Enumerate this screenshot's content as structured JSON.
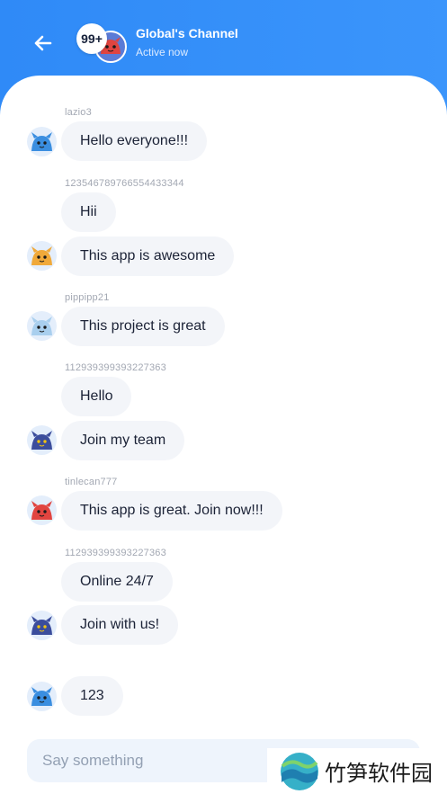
{
  "header": {
    "back_icon": "arrow-left-icon",
    "unread_count": "99+",
    "channel_name": "Global's Channel",
    "status": "Active now"
  },
  "messages": [
    {
      "sender": "lazio3",
      "text": "Hello everyone!!!",
      "avatar": "blue-dragon-avatar"
    },
    {
      "sender": "123546789766554433344",
      "text": "Hii",
      "avatar": ""
    },
    {
      "sender": "",
      "text": "This app is awesome",
      "avatar": "orange-dragon-avatar"
    },
    {
      "sender": "pippipp21",
      "text": "This project is great",
      "avatar": "light-blue-dragon-avatar"
    },
    {
      "sender": "112939399393227363",
      "text": "Hello",
      "avatar": ""
    },
    {
      "sender": "",
      "text": "Join my team",
      "avatar": "dark-blue-dragon-avatar"
    },
    {
      "sender": "tinlecan777",
      "text": "This app is great. Join now!!!",
      "avatar": "red-dragon-avatar"
    },
    {
      "sender": "112939399393227363",
      "text": "Online 24/7",
      "avatar": ""
    },
    {
      "sender": "",
      "text": "Join with us!",
      "avatar": "dark-blue-dragon-avatar"
    },
    {
      "sender": "",
      "text": "123",
      "avatar": "blue-dragon-avatar"
    }
  ],
  "composer": {
    "placeholder": "Say something"
  },
  "watermark": {
    "text": "竹笋软件园"
  },
  "colors": {
    "header_gradient_start": "#2f8af7",
    "header_gradient_end": "#3b95fb",
    "bubble_bg": "#f3f5f9",
    "input_bg": "#eef4fc"
  }
}
